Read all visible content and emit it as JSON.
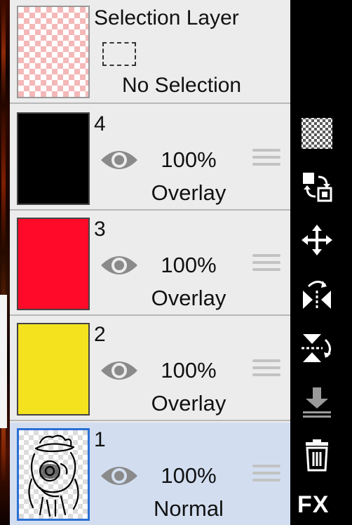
{
  "selection_layer": {
    "title": "Selection Layer",
    "status": "No Selection"
  },
  "layers": [
    {
      "number": "4",
      "opacity": "100%",
      "blend_mode": "Overlay",
      "color": "#000000",
      "visible": true,
      "selected": false
    },
    {
      "number": "3",
      "opacity": "100%",
      "blend_mode": "Overlay",
      "color": "#ff0a28",
      "visible": true,
      "selected": false
    },
    {
      "number": "2",
      "opacity": "100%",
      "blend_mode": "Overlay",
      "color": "#f5e21e",
      "visible": true,
      "selected": false
    },
    {
      "number": "1",
      "opacity": "100%",
      "blend_mode": "Normal",
      "color": "sketch",
      "visible": true,
      "selected": true
    }
  ],
  "toolbar": {
    "items": [
      {
        "icon": "transparency-checker-icon"
      },
      {
        "icon": "swap-layers-icon"
      },
      {
        "icon": "move-arrows-icon"
      },
      {
        "icon": "flip-horizontal-icon"
      },
      {
        "icon": "flip-vertical-icon"
      },
      {
        "icon": "merge-down-icon"
      },
      {
        "icon": "trash-icon"
      }
    ],
    "fx_label": "FX"
  },
  "colors": {
    "panel_bg": "#ececec",
    "selected_row_bg": "#d2def0",
    "selected_border": "#2a6fd6",
    "eye_gray": "#8a8a8a"
  }
}
